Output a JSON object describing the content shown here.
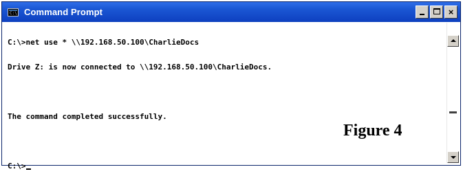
{
  "window": {
    "title": "Command Prompt",
    "icon": "console-icon",
    "controls": [
      "minimize-icon",
      "maximize-icon",
      "close-icon"
    ],
    "close_glyph": "×"
  },
  "console": {
    "lines": [
      "C:\\>net use * \\\\192.168.50.100\\CharlieDocs",
      "Drive Z: is now connected to \\\\192.168.50.100\\CharlieDocs.",
      "",
      "The command completed successfully.",
      "",
      "C:\\>"
    ]
  },
  "annotation": {
    "figure_label": "Figure 4"
  }
}
